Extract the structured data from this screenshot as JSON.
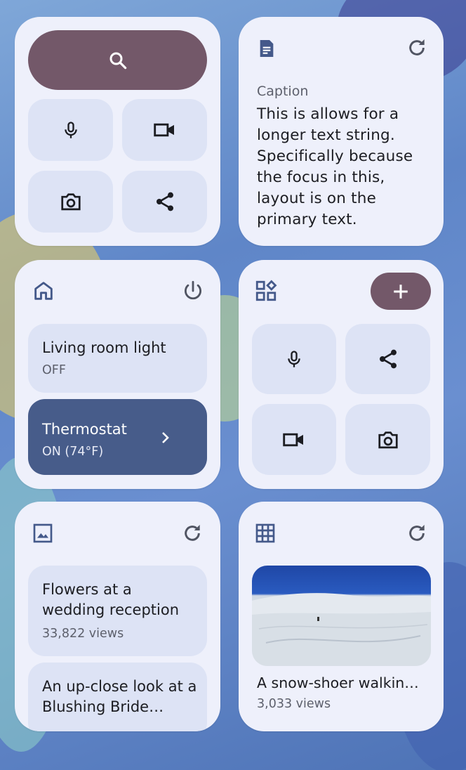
{
  "search_card": {
    "icons": [
      "search-icon",
      "mic-icon",
      "videocam-icon",
      "camera-icon",
      "share-icon"
    ]
  },
  "text_card": {
    "caption": "Caption",
    "body": "This is allows for a longer text string. Specifically because the focus in this, layout is on the primary text."
  },
  "home_card": {
    "devices": [
      {
        "name": "Living room light",
        "status": "OFF"
      },
      {
        "name": "Thermostat",
        "status": "ON (74°F)"
      }
    ]
  },
  "shortcuts_card": {
    "icons": [
      "widgets-icon",
      "add-icon",
      "mic-icon",
      "share-icon",
      "videocam-icon",
      "camera-icon"
    ]
  },
  "list_card": {
    "items": [
      {
        "title": "Flowers at a wedding reception",
        "views": "33,822 views"
      },
      {
        "title": "An up-close look at a Blushing Bride…",
        "views": ""
      }
    ]
  },
  "media_card": {
    "title": "A snow-shoer walkin…",
    "views": "3,033 views"
  },
  "colors": {
    "accent": "#735869",
    "card": "#eef0fb",
    "tile": "#dde3f5",
    "active_tile": "#475c8a"
  }
}
